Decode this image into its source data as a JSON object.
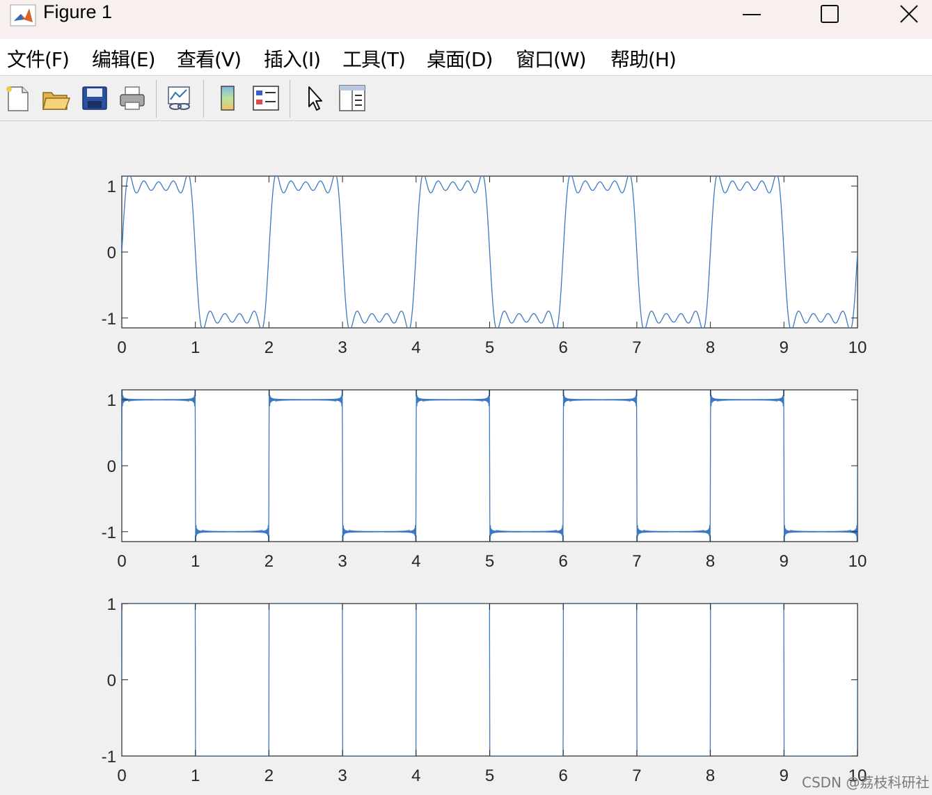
{
  "window": {
    "title": "Figure 1",
    "minimize_symbol": "—",
    "maximize_symbol": "☐",
    "close_symbol": "✕"
  },
  "menu": {
    "items": [
      "文件(F)",
      "编辑(E)",
      "查看(V)",
      "插入(I)",
      "工具(T)",
      "桌面(D)",
      "窗口(W)",
      "帮助(H)"
    ]
  },
  "toolbar": {
    "icons": [
      "new-figure-icon",
      "open-file-icon",
      "save-icon",
      "print-icon",
      "link-plot-icon",
      "colorbar-icon",
      "legend-icon",
      "pointer-icon",
      "property-editor-icon"
    ]
  },
  "colors": {
    "line": "#3a78c2",
    "background": "#f0f0f0",
    "axes_background": "#ffffff"
  },
  "chart_data": [
    {
      "type": "line",
      "description": "Fourier series approximation of square wave (few harmonics)",
      "xlim": [
        0,
        10
      ],
      "ylim": [
        -1.15,
        1.15
      ],
      "xticks": [
        "0",
        "1",
        "2",
        "3",
        "4",
        "5",
        "6",
        "7",
        "8",
        "9",
        "10"
      ],
      "yticks": [
        "-1",
        "0",
        "1"
      ],
      "harmonics": 9,
      "period": 2,
      "grid": false
    },
    {
      "type": "line",
      "description": "Fourier series approximation of square wave (many harmonics)",
      "xlim": [
        0,
        10
      ],
      "ylim": [
        -1.15,
        1.15
      ],
      "xticks": [
        "0",
        "1",
        "2",
        "3",
        "4",
        "5",
        "6",
        "7",
        "8",
        "9",
        "10"
      ],
      "yticks": [
        "-1",
        "0",
        "1"
      ],
      "harmonics": 199,
      "period": 2,
      "grid": false
    },
    {
      "type": "line",
      "description": "Ideal square wave",
      "xlim": [
        0,
        10
      ],
      "ylim": [
        -1,
        1
      ],
      "xticks": [
        "0",
        "1",
        "2",
        "3",
        "4",
        "5",
        "6",
        "7",
        "8",
        "9",
        "10"
      ],
      "yticks": [
        "-1",
        "0",
        "1"
      ],
      "harmonics": 0,
      "period": 2,
      "grid": false
    }
  ],
  "watermark": "CSDN @荔枝科研社"
}
